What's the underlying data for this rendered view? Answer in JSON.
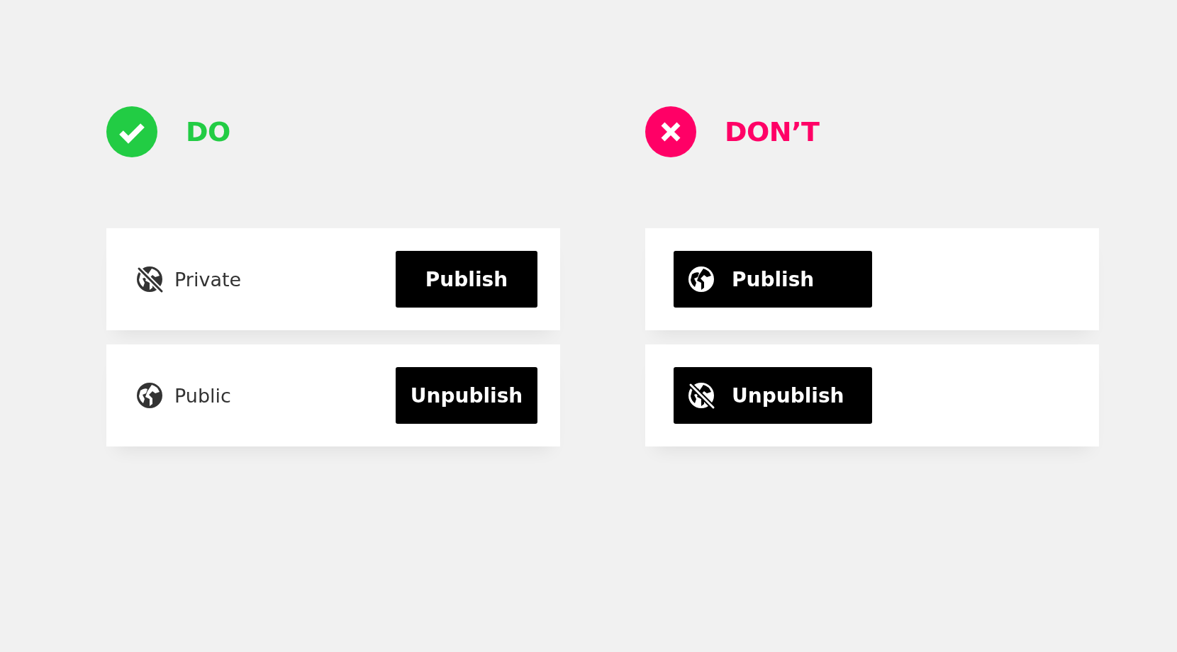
{
  "columns": [
    {
      "kind": "do",
      "title": "DO",
      "color": "#22cc44",
      "rows": [
        {
          "status": {
            "kind": "private",
            "label": "Private"
          },
          "button": {
            "label": "Publish"
          }
        },
        {
          "status": {
            "kind": "public",
            "label": "Public"
          },
          "button": {
            "label": "Unpublish"
          }
        }
      ]
    },
    {
      "kind": "dont",
      "title": "DON’T",
      "color": "#ff0066",
      "rows": [
        {
          "button": {
            "label": "Publish",
            "kind": "public"
          }
        },
        {
          "button": {
            "label": "Unpublish",
            "kind": "private"
          }
        }
      ]
    }
  ]
}
